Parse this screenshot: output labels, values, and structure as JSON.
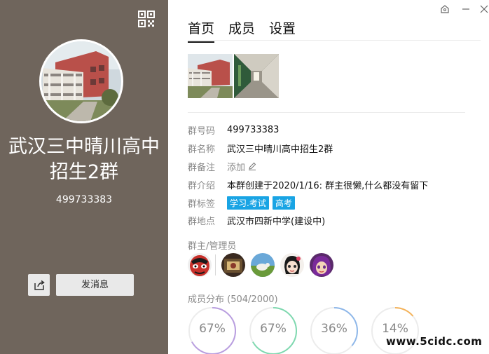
{
  "window": {
    "controls": [
      "skin-icon",
      "minimize-icon",
      "close-icon"
    ]
  },
  "left_panel": {
    "background": "#6f655c",
    "group_name": "武汉三中晴川高中招生2群",
    "group_id": "499733383",
    "send_message_label": "发消息"
  },
  "tabs": [
    {
      "label": "首页",
      "active": true
    },
    {
      "label": "成员",
      "active": false
    },
    {
      "label": "设置",
      "active": false
    }
  ],
  "info": {
    "number": {
      "label": "群号码",
      "value": "499733383"
    },
    "name": {
      "label": "群名称",
      "value": "武汉三中晴川高中招生2群"
    },
    "remark": {
      "label": "群备注",
      "value": "添加"
    },
    "intro": {
      "label": "群介绍",
      "value": "本群创建于2020/1/16:  群主很懒,什么都没有留下"
    },
    "tags": {
      "label": "群标签",
      "values": [
        "学习.考试",
        "高考"
      ]
    },
    "location": {
      "label": "群地点",
      "value": "武汉市四新中学(建设中)"
    }
  },
  "admins_label": "群主/管理员",
  "members": {
    "label": "成员分布",
    "count_text": "(504/2000)",
    "distribution": [
      {
        "percent": "67%",
        "value": 67,
        "color": "#b99ee0"
      },
      {
        "percent": "67%",
        "value": 67,
        "color": "#7fd9b0"
      },
      {
        "percent": "36%",
        "value": 36,
        "color": "#8fb8ea"
      },
      {
        "percent": "14%",
        "value": 14,
        "color": "#f5b35a"
      }
    ]
  },
  "colors": {
    "tag": "#19a4e4",
    "accent_text": "#111111"
  },
  "watermark": "www.5cidc.com"
}
